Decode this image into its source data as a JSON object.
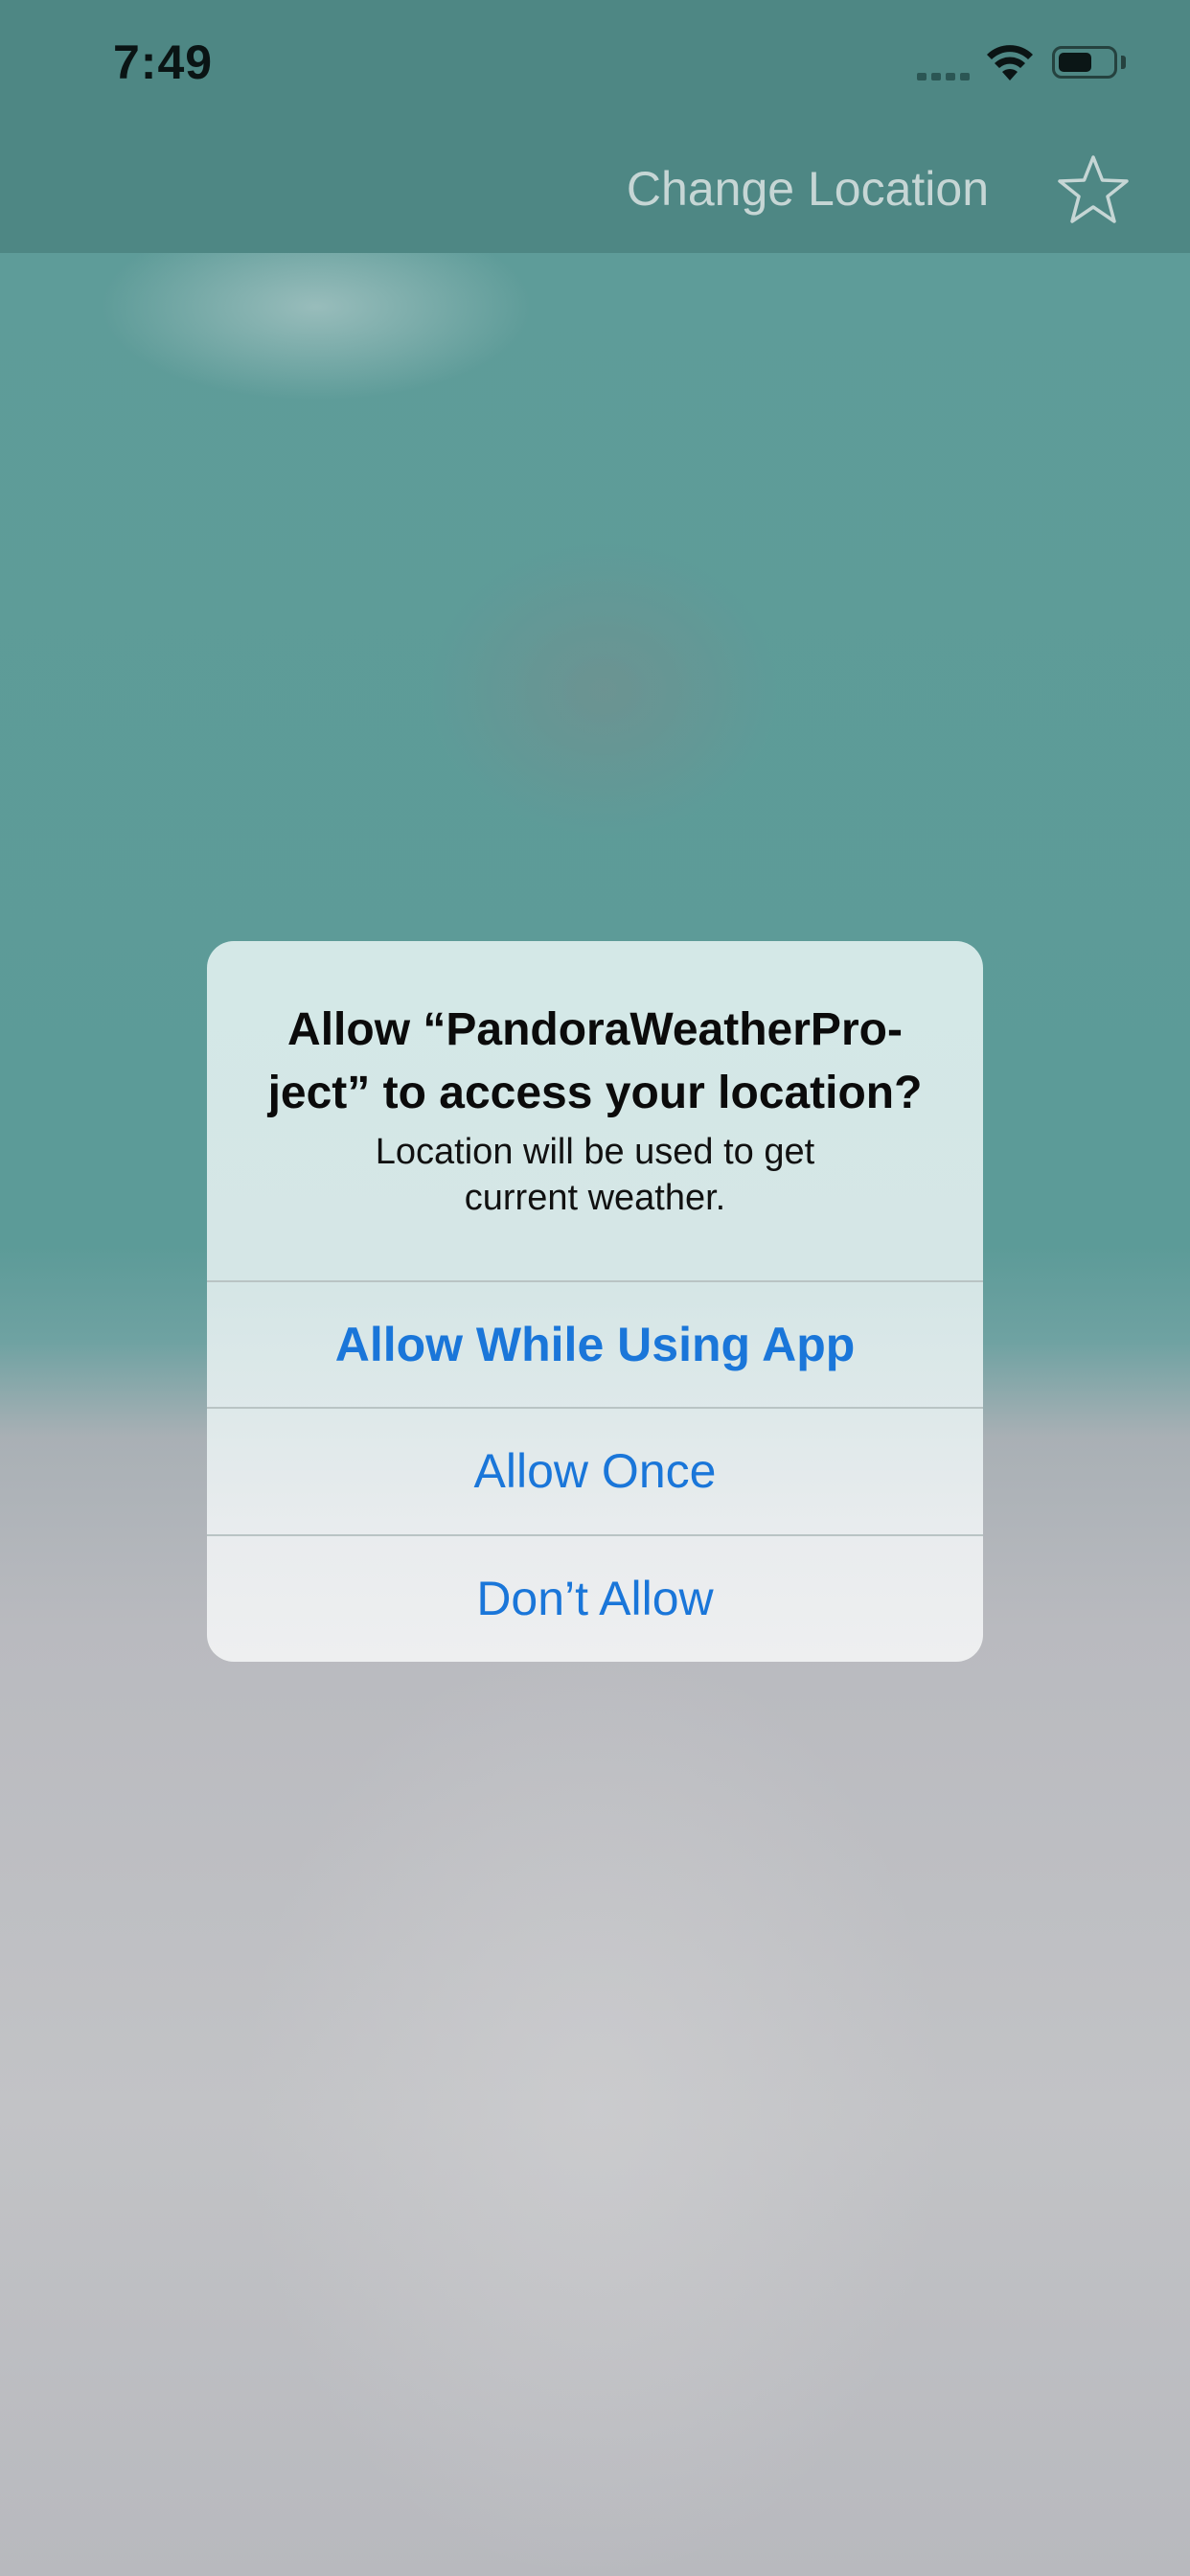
{
  "status_bar": {
    "time": "7:49"
  },
  "nav": {
    "change_location_label": "Change Location",
    "favorite_icon": "star-outline-icon"
  },
  "alert": {
    "title": "Allow “PandoraWeatherPro-ject” to access your location?",
    "title_line1": "Allow “PandoraWeatherPro-",
    "title_line2": "ject” to access your location?",
    "message_line1": "Location will be used to get",
    "message_line2": "current weather.",
    "buttons": [
      {
        "label": "Allow While Using App",
        "style": "bold"
      },
      {
        "label": "Allow Once",
        "style": "regular"
      },
      {
        "label": "Don’t Allow",
        "style": "regular"
      }
    ]
  },
  "colors": {
    "nav_background": "#4e8784",
    "background_teal": "#5f9c99",
    "background_gray": "#c2c3c6",
    "alert_button_blue": "#1a76d9"
  }
}
